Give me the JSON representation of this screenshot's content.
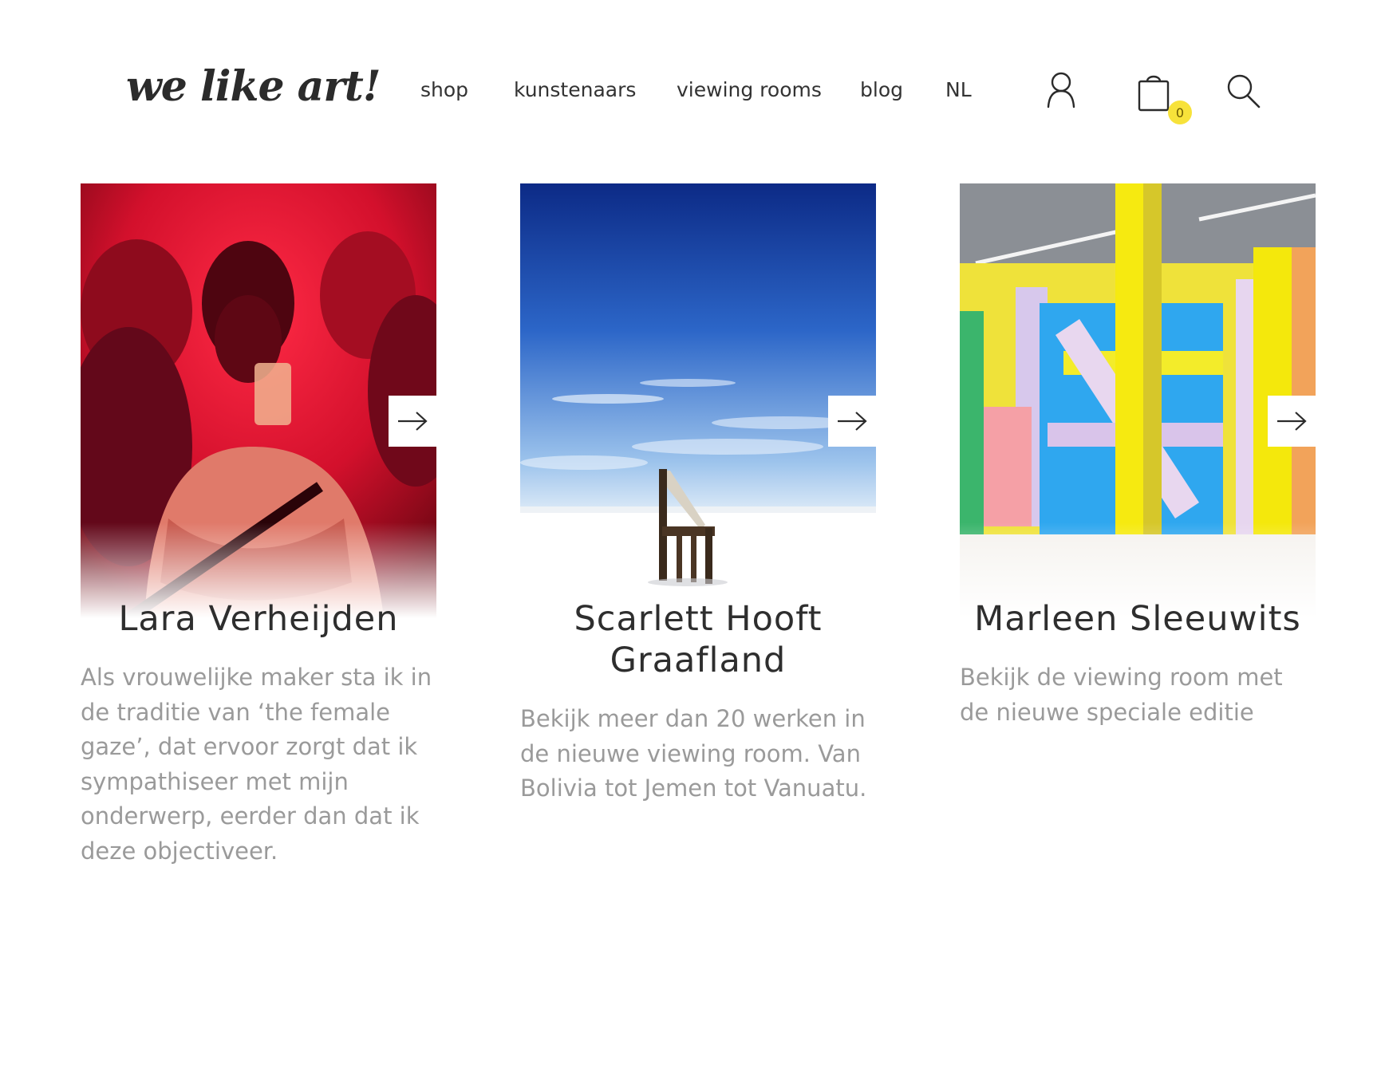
{
  "header": {
    "logo": "we like art!",
    "nav": [
      {
        "label": "shop"
      },
      {
        "label": "kunstenaars"
      },
      {
        "label": "viewing rooms"
      },
      {
        "label": "blog"
      },
      {
        "label": "NL"
      }
    ],
    "icons": {
      "account": "user-icon",
      "cart": "shopping-bag-icon",
      "search": "search-icon"
    },
    "cart_count": "0",
    "badge_color": "#f7e23a"
  },
  "cards": [
    {
      "title": "Lara Verheijden",
      "description": "Als vrouwelijke maker sta ik in de traditie van ‘the female gaze’, dat ervoor zorgt dat ik sympathiseer met mijn onderwerp, eerder dan dat ik deze objectiveer."
    },
    {
      "title": "Scarlett Hooft Graafland",
      "description": "Bekijk meer dan 20 werken in de nieuwe viewing room. Van Bolivia tot Jemen tot Vanuatu."
    },
    {
      "title": "Marleen Sleeuwits",
      "description": "Bekijk de viewing room met de nieuwe speciale editie"
    }
  ]
}
